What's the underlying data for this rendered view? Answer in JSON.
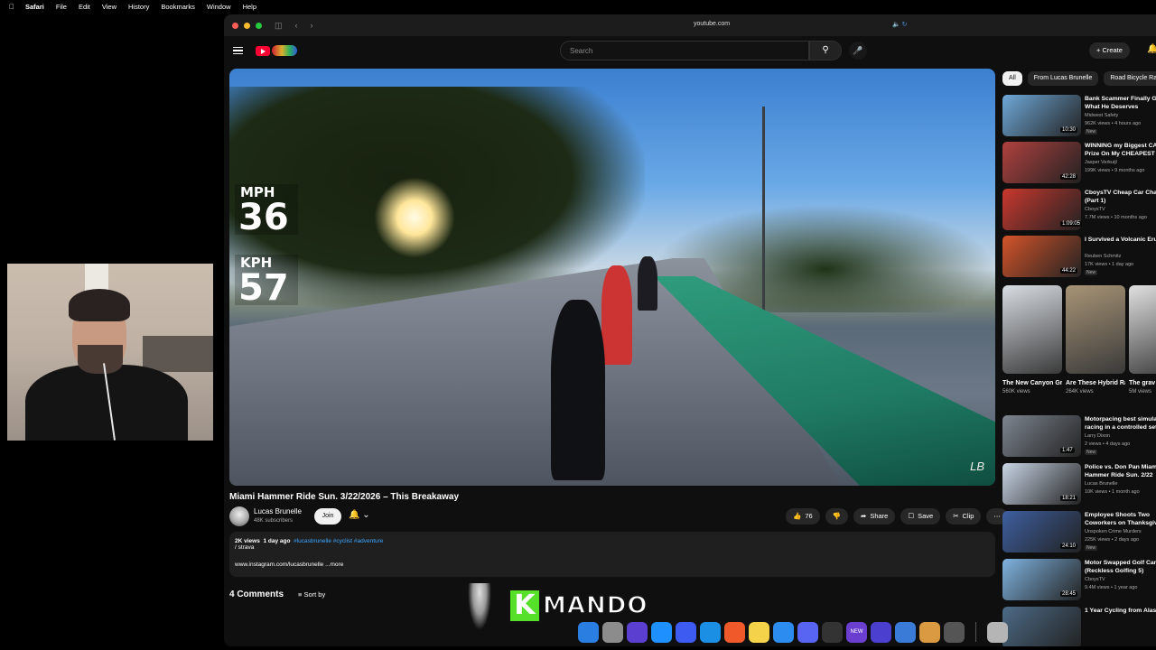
{
  "menubar": {
    "apple": "",
    "app": "Safari",
    "items": [
      "File",
      "Edit",
      "View",
      "History",
      "Bookmarks",
      "Window",
      "Help"
    ]
  },
  "browser": {
    "url": "youtube.com"
  },
  "youtube": {
    "search_placeholder": "Search",
    "create_label": "Create",
    "player": {
      "mph_label": "MPH",
      "mph_value": "36",
      "kph_label": "KPH",
      "kph_value": "57",
      "watermark": "LB"
    },
    "video": {
      "title": "Miami Hammer Ride Sun. 3/22/2026 – This Breakaway",
      "channel": "Lucas Brunelle",
      "subscribers": "48K subscribers",
      "join_label": "Join",
      "likes": "76",
      "share_label": "Share",
      "save_label": "Save",
      "clip_label": "Clip",
      "views": "2K views",
      "date": "1 day ago",
      "tags": "#lucasbrunelle #cyclist #adventure",
      "strava": "/ strava",
      "link": "www.instagram.com/lucasbrunelle",
      "more": "...more"
    },
    "comments": {
      "count_label": "4 Comments",
      "sort_label": "Sort by"
    },
    "chips": [
      "All",
      "From Lucas Brunelle",
      "Road Bicycle Rac"
    ],
    "recommendations": [
      {
        "title": "Bank Scammer Finally G",
        "title2": "What He Deserves",
        "channel": "Midwest Safety",
        "meta": "962K views • 4 hours ago",
        "badge": "New",
        "duration": "10:30",
        "color": "#6fa8d8"
      },
      {
        "title": "WINNING my Biggest CA",
        "title2": "Prize On My CHEAPEST",
        "channel": "Jasper Verkuijl",
        "meta": "199K views • 9 months ago",
        "badge": "",
        "duration": "42:28",
        "color": "#b0413e"
      },
      {
        "title": "CboysTV Cheap Car Cha",
        "title2": "(Part 1)",
        "channel": "CboysTV",
        "meta": "7.7M views • 10 months ago",
        "badge": "",
        "duration": "1:09:05",
        "color": "#c8382e"
      },
      {
        "title": "I Survived a Volcanic Eru",
        "title2": "",
        "channel": "Reuben Schmitz",
        "meta": "17K views • 1 day ago",
        "badge": "New",
        "duration": "44:22",
        "color": "#d4542a"
      }
    ],
    "shorts": [
      {
        "title": "The New Canyon Gri...",
        "views": "560K views",
        "color": "#d8dde3"
      },
      {
        "title": "Are These Hybrid Rac...",
        "views": "264K views",
        "color": "#a89476"
      },
      {
        "title": "The grav bike of t",
        "views": "5M views",
        "color": "#e0e0e0"
      }
    ],
    "recommendations2": [
      {
        "title": "Motorpacing best simula",
        "title2": "racing in a controlled set",
        "channel": "Larry Dixon",
        "meta": "2 views • 4 days ago",
        "badge": "New",
        "duration": "1:47",
        "color": "#7d8590"
      },
      {
        "title": "Police vs. Don Pan Miam",
        "title2": "Hammer Ride Sun. 2/22",
        "channel": "Lucas Brunelle",
        "meta": "10K views • 1 month ago",
        "badge": "",
        "duration": "18:21",
        "color": "#c9d5e6"
      },
      {
        "title": "Employee Shoots Two",
        "title2": "Coworkers on Thanksgiv",
        "channel": "Unspoken Crime Murders",
        "meta": "225K views • 2 days ago",
        "badge": "New",
        "duration": "24:10",
        "color": "#3d5fa0"
      },
      {
        "title": "Motor Swapped Golf Car",
        "title2": "(Reckless Golfing 5)",
        "channel": "CboysTV",
        "meta": "9.4M views • 1 year ago",
        "badge": "",
        "duration": "28:45",
        "color": "#7fb3e0"
      },
      {
        "title": "1 Year Cycling from Alas",
        "title2": "",
        "channel": "",
        "meta": "",
        "badge": "",
        "duration": "",
        "color": "#4c6a86"
      }
    ]
  },
  "overlay": {
    "logo_k": "K",
    "logo_text": "MANDO"
  },
  "dock": {
    "badge_mail": "412",
    "badge_news": "NEW",
    "items": [
      {
        "name": "finder",
        "color": "#2a7de1"
      },
      {
        "name": "launchpad",
        "color": "#8c8c8c"
      },
      {
        "name": "privacy",
        "color": "#5b3fd0"
      },
      {
        "name": "appstore",
        "color": "#1e90ff"
      },
      {
        "name": "arc",
        "color": "#3d5af1"
      },
      {
        "name": "safari",
        "color": "#1a8fe3"
      },
      {
        "name": "brave",
        "color": "#f05a2a"
      },
      {
        "name": "notes",
        "color": "#f4d24a"
      },
      {
        "name": "mail",
        "color": "#2d8cf0"
      },
      {
        "name": "discord",
        "color": "#5865f2"
      },
      {
        "name": "activity",
        "color": "#333"
      },
      {
        "name": "news",
        "color": "#6a3fd0"
      },
      {
        "name": "grid",
        "color": "#4b3fd0"
      },
      {
        "name": "finder2",
        "color": "#3b7bd8"
      },
      {
        "name": "box",
        "color": "#d99a42"
      },
      {
        "name": "obs",
        "color": "#555"
      },
      {
        "name": "trash",
        "color": "#b5b5b5"
      }
    ]
  }
}
